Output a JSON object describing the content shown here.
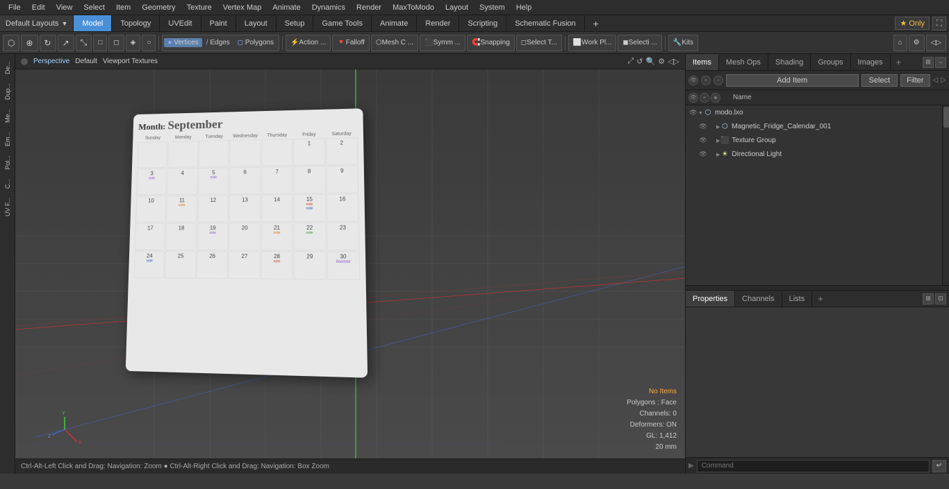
{
  "menu": {
    "items": [
      "File",
      "Edit",
      "View",
      "Select",
      "Item",
      "Geometry",
      "Texture",
      "Vertex Map",
      "Animate",
      "Dynamics",
      "Render",
      "MaxToModo",
      "Layout",
      "System",
      "Help"
    ]
  },
  "layout_bar": {
    "dropdown_label": "Default Layouts",
    "tabs": [
      "Model",
      "Topology",
      "UVEdit",
      "Paint",
      "Layout",
      "Setup",
      "Game Tools",
      "Animate",
      "Render",
      "Scripting",
      "Schematic Fusion"
    ],
    "active_tab": "Model",
    "plus_label": "+",
    "star_label": "★ Only"
  },
  "tools_bar": {
    "groups": [
      "Vertices",
      "Edges",
      "Polygons"
    ],
    "action_label": "Action ...",
    "falloff_label": "Falloff",
    "mesh_c_label": "Mesh C ...",
    "symm_label": "Symm ...",
    "snapping_label": "Snapping",
    "select_t_label": "Select T...",
    "work_pl_label": "Work Pl...",
    "selecti_label": "Selecti ...",
    "kits_label": "Kits"
  },
  "viewport": {
    "view_type": "Perspective",
    "shading": "Default",
    "texture": "Viewport Textures",
    "status": {
      "no_items": "No Items",
      "polygons": "Polygons : Face",
      "channels": "Channels: 0",
      "deformers": "Deformers: ON",
      "gl": "GL: 1,412",
      "size": "20 mm"
    }
  },
  "status_bar": {
    "text": "Ctrl-Alt-Left Click and Drag: Navigation: Zoom  ●  Ctrl-Alt-Right Click and Drag: Navigation: Box Zoom"
  },
  "right_panel": {
    "tabs": [
      "Items",
      "Mesh Ops",
      "Shading",
      "Groups",
      "Images"
    ],
    "active_tab": "Items",
    "add_item_label": "Add Item",
    "select_label": "Select",
    "filter_label": "Filter",
    "name_col": "Name",
    "items": [
      {
        "id": "modo-lxo",
        "label": "modo.lxo",
        "level": 1,
        "type": "mesh",
        "expand": true
      },
      {
        "id": "fridge-cal",
        "label": "Magnetic_Fridge_Calendar_001",
        "level": 2,
        "type": "mesh",
        "expand": false
      },
      {
        "id": "tex-group",
        "label": "Texture Group",
        "level": 2,
        "type": "texture",
        "expand": false
      },
      {
        "id": "dir-light",
        "label": "Directional Light",
        "level": 2,
        "type": "light",
        "expand": false
      }
    ],
    "properties": {
      "tabs": [
        "Properties",
        "Channels",
        "Lists"
      ],
      "active_tab": "Properties",
      "plus_label": "+"
    }
  },
  "command_bar": {
    "placeholder": "Command",
    "label": "Command"
  },
  "left_sidebar": {
    "tabs": [
      "De...",
      "Dup...",
      "Me...",
      "Em...",
      "Pol...",
      "C...",
      "UV F..."
    ]
  },
  "calendar": {
    "month_label": "Month:",
    "month_name": "September",
    "days": [
      "Sunday",
      "Monday",
      "Tuesday",
      "Wednesday",
      "Thursday",
      "Friday",
      "Saturday"
    ],
    "day_abbrs": [
      "Sunday",
      "Monday",
      "Tuesday",
      "Wednesday",
      "Thursday",
      "Friday",
      "Saturday"
    ]
  }
}
